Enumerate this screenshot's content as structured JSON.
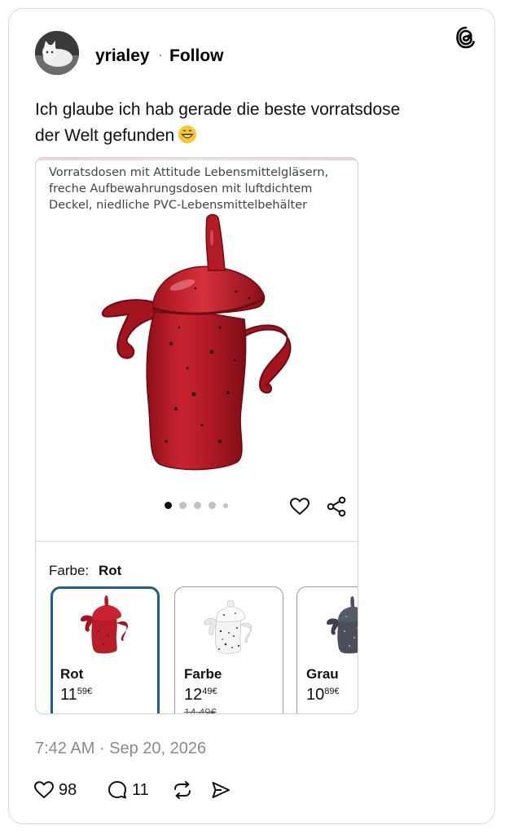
{
  "post": {
    "username": "yrialey",
    "separator": "·",
    "follow_label": "Follow",
    "text_lines": [
      "Ich glaube ich hab gerade die beste vorratsdose",
      "der Welt gefunden"
    ],
    "timestamp": "7:42 AM · Sep 20, 2026",
    "likes": "98",
    "replies": "11"
  },
  "icons": {
    "brand": "threads-logo-icon",
    "emoji": "grinning-face-emoji",
    "like": "heart-icon",
    "reply": "comment-icon",
    "repost": "repost-icon",
    "share": "send-icon"
  },
  "product": {
    "description_lines": [
      "Vorratsdosen mit Attitude Lebensmittelgläsern,",
      "freche Aufbewahrungsdosen mit luftdichtem",
      "Deckel, niedliche PVC-Lebensmittelbehälter"
    ],
    "carousel_total": 5,
    "carousel_active": 1,
    "color_label": "Farbe:",
    "selected_color": "Rot",
    "variants": [
      {
        "name": "Rot",
        "price_main": "11",
        "price_cents": "59",
        "currency": "€",
        "color": "#b81c28",
        "selected": true
      },
      {
        "name": "Farbe",
        "price_main": "12",
        "price_cents": "49",
        "currency": "€",
        "old_price": "14,49€",
        "color": "#f2f2f2"
      },
      {
        "name": "Grau",
        "price_main": "10",
        "price_cents": "89",
        "currency": "€",
        "color": "#4a4f5a"
      }
    ]
  },
  "colors": {
    "accent_selected": "#1f5d92",
    "jar_red": "#b81c28",
    "muted_text": "#8a8a8a"
  }
}
